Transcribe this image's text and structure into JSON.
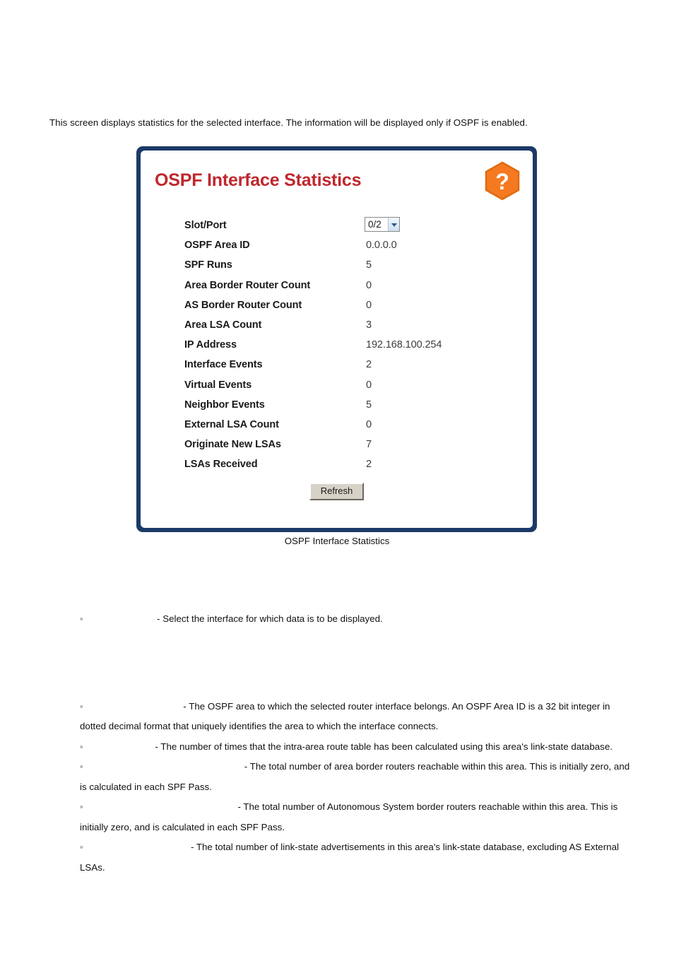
{
  "document": {
    "intro": "This screen displays statistics for the selected interface. The information will be displayed only if OSPF is enabled.",
    "figure_caption": "OSPF Interface Statistics"
  },
  "panel": {
    "title": "OSPF Interface Statistics",
    "help_icon": "question-mark-hexagon-icon",
    "border_color": "#1b3a67",
    "title_color": "#c0272d",
    "help_icon_color": "#f57920",
    "refresh_label": "Refresh",
    "slot_port": {
      "label": "Slot/Port",
      "value": "0/2",
      "options": [
        "0/2"
      ]
    },
    "fields": [
      {
        "label": "OSPF Area ID",
        "value": "0.0.0.0"
      },
      {
        "label": "SPF Runs",
        "value": "5"
      },
      {
        "label": "Area Border Router Count",
        "value": "0"
      },
      {
        "label": "AS Border Router Count",
        "value": "0"
      },
      {
        "label": "Area LSA Count",
        "value": "3"
      },
      {
        "label": "IP Address",
        "value": "192.168.100.254"
      },
      {
        "label": "Interface Events",
        "value": "2"
      },
      {
        "label": "Virtual Events",
        "value": "0"
      },
      {
        "label": "Neighbor Events",
        "value": "5"
      },
      {
        "label": "External LSA Count",
        "value": "0"
      },
      {
        "label": "Originate New LSAs",
        "value": "7"
      },
      {
        "label": "LSAs Received",
        "value": "2"
      }
    ]
  },
  "bullets": [
    {
      "indent_ems": 8.2,
      "text": "- Select the interface for which data is to be displayed."
    },
    {
      "indent_ems": 11.0,
      "text": "- The OSPF area to which the selected router interface belongs. An OSPF Area ID is a 32 bit integer in dotted decimal format that uniquely identifies the area to which the interface connects."
    },
    {
      "indent_ems": 8.0,
      "text": "- The number of times that the intra-area route table has been calculated using this area's link-state database."
    },
    {
      "indent_ems": 17.5,
      "text": "- The total number of area border routers reachable within this area. This is initially zero, and is calculated in each SPF Pass."
    },
    {
      "indent_ems": 16.8,
      "text": "- The total number of Autonomous System border routers reachable within this area. This is initially zero, and is calculated in each SPF Pass."
    },
    {
      "indent_ems": 11.8,
      "text": "- The total number of link-state advertisements in this area's link-state database, excluding AS External LSAs."
    }
  ]
}
